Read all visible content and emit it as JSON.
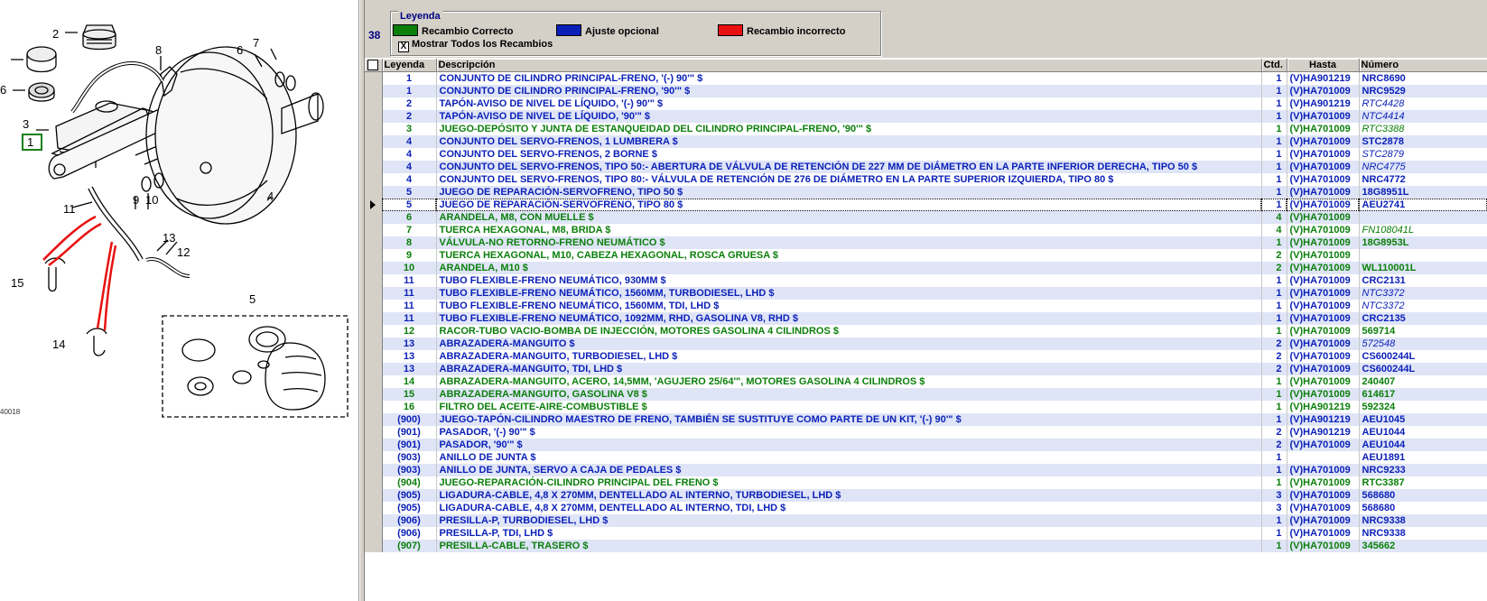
{
  "diagram": {
    "callouts": [
      "1",
      "2",
      "3",
      "4",
      "5",
      "6",
      "6",
      "7",
      "8",
      "9",
      "10",
      "11",
      "12",
      "13",
      "14",
      "15"
    ],
    "reference": "40018"
  },
  "header": {
    "count": "38",
    "legend": {
      "title": "Leyenda",
      "green_label": "Recambio Correcto",
      "blue_label": "Ajuste opcional",
      "red_label": "Recambio incorrecto",
      "show_all_label": "Mostrar Todos los Recambios",
      "show_all_checked": "X"
    },
    "colors": {
      "green": "#0b7f0b",
      "blue": "#0a1fb8",
      "red": "#e81010"
    }
  },
  "grid": {
    "columns": [
      "Leyenda",
      "Descripción",
      "Ctd.",
      "Hasta",
      "Número"
    ],
    "rows": [
      {
        "leg": "1",
        "desc": "CONJUNTO DE CILINDRO PRINCIPAL-FRENO, '(-) 90'\" $",
        "qty": "1",
        "until": "(V)HA901219",
        "num": "NRC8690",
        "color": "blue"
      },
      {
        "leg": "1",
        "desc": "CONJUNTO DE CILINDRO PRINCIPAL-FRENO, '90'\" $",
        "qty": "1",
        "until": "(V)HA701009",
        "num": "NRC9529",
        "color": "blue"
      },
      {
        "leg": "2",
        "desc": "TAPÓN-AVISO DE NIVEL DE LÍQUIDO, '(-) 90'\" $",
        "qty": "1",
        "until": "(V)HA901219",
        "num": "RTC4428",
        "color": "blue",
        "num_italic": true
      },
      {
        "leg": "2",
        "desc": "TAPÓN-AVISO DE NIVEL DE LÍQUIDO, '90'\" $",
        "qty": "1",
        "until": "(V)HA701009",
        "num": "NTC4414",
        "color": "blue",
        "num_italic": true
      },
      {
        "leg": "3",
        "desc": "JUEGO-DEPÓSITO Y JUNTA DE ESTANQUEIDAD DEL CILINDRO PRINCIPAL-FRENO, '90'\" $",
        "qty": "1",
        "until": "(V)HA701009",
        "num": "RTC3388",
        "color": "green",
        "num_italic": true
      },
      {
        "leg": "4",
        "desc": "CONJUNTO DEL SERVO-FRENOS, 1 LUMBRERA $",
        "qty": "1",
        "until": "(V)HA701009",
        "num": "STC2878",
        "color": "blue"
      },
      {
        "leg": "4",
        "desc": "CONJUNTO DEL SERVO-FRENOS, 2 BORNE $",
        "qty": "1",
        "until": "(V)HA701009",
        "num": "STC2879",
        "color": "blue",
        "num_italic": true
      },
      {
        "leg": "4",
        "desc": "CONJUNTO DEL SERVO-FRENOS, TIPO 50:- ABERTURA DE VÁLVULA DE RETENCIÓN DE 227 MM DE DIÁMETRO EN LA PARTE INFERIOR DERECHA, TIPO 50 $",
        "qty": "1",
        "until": "(V)HA701009",
        "num": "NRC4775",
        "color": "blue",
        "num_italic": true
      },
      {
        "leg": "4",
        "desc": "CONJUNTO DEL SERVO-FRENOS, TIPO 80:- VÁLVULA DE RETENCIÓN DE 276 DE DIÁMETRO EN LA PARTE SUPERIOR IZQUIERDA, TIPO 80 $",
        "qty": "1",
        "until": "(V)HA701009",
        "num": "NRC4772",
        "color": "blue"
      },
      {
        "leg": "5",
        "desc": "JUEGO DE REPARACIÓN-SERVOFRENO, TIPO 50 $",
        "qty": "1",
        "until": "(V)HA701009",
        "num": "18G8951L",
        "color": "blue"
      },
      {
        "leg": "5",
        "desc": "JUEGO DE REPARACIÓN-SERVOFRENO, TIPO 80 $",
        "qty": "1",
        "until": "(V)HA701009",
        "num": "AEU2741",
        "color": "blue",
        "current": true
      },
      {
        "leg": "6",
        "desc": "ARANDELA, M8, CON MUELLE $",
        "qty": "4",
        "until": "(V)HA701009",
        "num": "",
        "color": "green"
      },
      {
        "leg": "7",
        "desc": "TUERCA HEXAGONAL, M8, BRIDA $",
        "qty": "4",
        "until": "(V)HA701009",
        "num": "FN108041L",
        "color": "green",
        "num_italic": true
      },
      {
        "leg": "8",
        "desc": "VÁLVULA-NO RETORNO-FRENO NEUMÁTICO $",
        "qty": "1",
        "until": "(V)HA701009",
        "num": "18G8953L",
        "color": "green"
      },
      {
        "leg": "9",
        "desc": "TUERCA HEXAGONAL, M10, CABEZA HEXAGONAL, ROSCA GRUESA $",
        "qty": "2",
        "until": "(V)HA701009",
        "num": "",
        "color": "green"
      },
      {
        "leg": "10",
        "desc": "ARANDELA, M10 $",
        "qty": "2",
        "until": "(V)HA701009",
        "num": "WL110001L",
        "color": "green"
      },
      {
        "leg": "11",
        "desc": "TUBO FLEXIBLE-FRENO NEUMÁTICO, 930MM $",
        "qty": "1",
        "until": "(V)HA701009",
        "num": "CRC2131",
        "color": "blue"
      },
      {
        "leg": "11",
        "desc": "TUBO FLEXIBLE-FRENO NEUMÁTICO, 1560MM, TURBODIESEL, LHD $",
        "qty": "1",
        "until": "(V)HA701009",
        "num": "NTC3372",
        "color": "blue",
        "num_italic": true
      },
      {
        "leg": "11",
        "desc": "TUBO FLEXIBLE-FRENO NEUMÁTICO, 1560MM, TDI, LHD $",
        "qty": "1",
        "until": "(V)HA701009",
        "num": "NTC3372",
        "color": "blue",
        "num_italic": true
      },
      {
        "leg": "11",
        "desc": "TUBO FLEXIBLE-FRENO NEUMÁTICO, 1092MM, RHD, GASOLINA V8, RHD $",
        "qty": "1",
        "until": "(V)HA701009",
        "num": "CRC2135",
        "color": "blue"
      },
      {
        "leg": "12",
        "desc": "RACOR-TUBO VACIO-BOMBA DE INJECCIÓN, MOTORES GASOLINA 4 CILINDROS $",
        "qty": "1",
        "until": "(V)HA701009",
        "num": "569714",
        "color": "green"
      },
      {
        "leg": "13",
        "desc": "ABRAZADERA-MANGUITO $",
        "qty": "2",
        "until": "(V)HA701009",
        "num": "572548",
        "color": "blue",
        "num_italic": true
      },
      {
        "leg": "13",
        "desc": "ABRAZADERA-MANGUITO, TURBODIESEL, LHD $",
        "qty": "2",
        "until": "(V)HA701009",
        "num": "CS600244L",
        "color": "blue"
      },
      {
        "leg": "13",
        "desc": "ABRAZADERA-MANGUITO, TDI, LHD $",
        "qty": "2",
        "until": "(V)HA701009",
        "num": "CS600244L",
        "color": "blue"
      },
      {
        "leg": "14",
        "desc": "ABRAZADERA-MANGUITO, ACERO, 14,5MM, 'AGUJERO 25/64'\", MOTORES GASOLINA 4 CILINDROS $",
        "qty": "1",
        "until": "(V)HA701009",
        "num": "240407",
        "color": "green"
      },
      {
        "leg": "15",
        "desc": "ABRAZADERA-MANGUITO, GASOLINA V8 $",
        "qty": "1",
        "until": "(V)HA701009",
        "num": "614617",
        "color": "green"
      },
      {
        "leg": "16",
        "desc": "FILTRO DEL ACEITE-AIRE-COMBUSTIBLE $",
        "qty": "1",
        "until": "(V)HA901219",
        "num": "592324",
        "color": "green"
      },
      {
        "leg": "(900)",
        "desc": "JUEGO-TAPÓN-CILINDRO MAESTRO DE FRENO, TAMBIÉN SE SUSTITUYE COMO PARTE DE UN KIT, '(-) 90'\" $",
        "qty": "1",
        "until": "(V)HA901219",
        "num": "AEU1045",
        "color": "blue"
      },
      {
        "leg": "(901)",
        "desc": "PASADOR, '(-) 90'\" $",
        "qty": "2",
        "until": "(V)HA901219",
        "num": "AEU1044",
        "color": "blue"
      },
      {
        "leg": "(901)",
        "desc": "PASADOR, '90'\" $",
        "qty": "2",
        "until": "(V)HA701009",
        "num": "AEU1044",
        "color": "blue"
      },
      {
        "leg": "(903)",
        "desc": "ANILLO DE JUNTA $",
        "qty": "1",
        "until": "",
        "num": "AEU1891",
        "color": "blue"
      },
      {
        "leg": "(903)",
        "desc": "ANILLO DE JUNTA, SERVO A CAJA DE PEDALES $",
        "qty": "1",
        "until": "(V)HA701009",
        "num": "NRC9233",
        "color": "blue"
      },
      {
        "leg": "(904)",
        "desc": "JUEGO-REPARACIÓN-CILINDRO PRINCIPAL DEL FRENO $",
        "qty": "1",
        "until": "(V)HA701009",
        "num": "RTC3387",
        "color": "green"
      },
      {
        "leg": "(905)",
        "desc": "LIGADURA-CABLE, 4,8 X 270MM, DENTELLADO AL INTERNO, TURBODIESEL, LHD $",
        "qty": "3",
        "until": "(V)HA701009",
        "num": "568680",
        "color": "blue"
      },
      {
        "leg": "(905)",
        "desc": "LIGADURA-CABLE, 4,8 X 270MM, DENTELLADO AL INTERNO, TDI, LHD $",
        "qty": "3",
        "until": "(V)HA701009",
        "num": "568680",
        "color": "blue"
      },
      {
        "leg": "(906)",
        "desc": "PRESILLA-P, TURBODIESEL, LHD $",
        "qty": "1",
        "until": "(V)HA701009",
        "num": "NRC9338",
        "color": "blue"
      },
      {
        "leg": "(906)",
        "desc": "PRESILLA-P, TDI, LHD $",
        "qty": "1",
        "until": "(V)HA701009",
        "num": "NRC9338",
        "color": "blue"
      },
      {
        "leg": "(907)",
        "desc": "PRESILLA-CABLE, TRASERO $",
        "qty": "1",
        "until": "(V)HA701009",
        "num": "345662",
        "color": "green"
      }
    ]
  }
}
